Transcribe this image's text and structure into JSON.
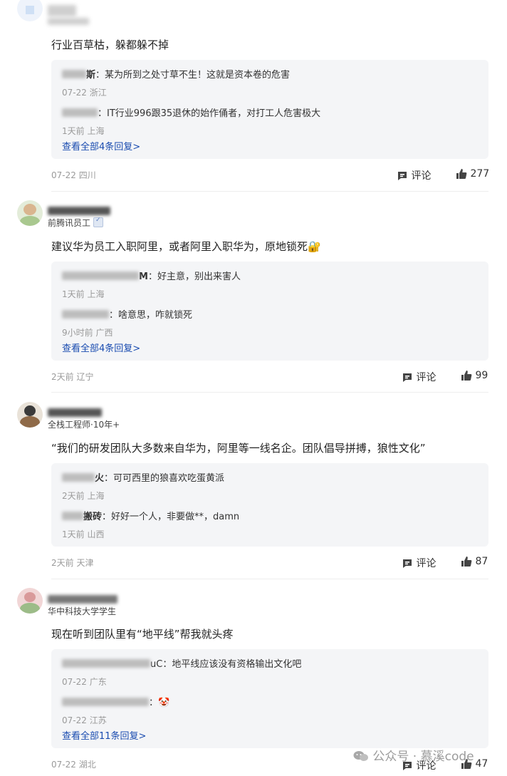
{
  "comments": [
    {
      "name_visible": "",
      "author_title": "",
      "verified": false,
      "text": "行业百草枯，躲都躲不掉",
      "replies": [
        {
          "name_tail": "斯",
          "text": "：某为所到之处寸草不生！这就是资本卷的危害",
          "date": "07-22",
          "location": "浙江"
        },
        {
          "name_tail": "",
          "text": "：IT行业996跟35退休的始作俑者，对打工人危害极大",
          "date": "1天前",
          "location": "上海"
        }
      ],
      "view_all": "查看全部4条回复>",
      "date": "07-22",
      "location": "四川",
      "comment_label": "评论",
      "likes": "277"
    },
    {
      "name_visible": "",
      "author_title": "前腾讯员工",
      "verified": true,
      "text": "建议华为员工入职阿里，或者阿里入职华为，原地锁死🔐",
      "replies": [
        {
          "name_tail": "M",
          "text": "：好主意，别出来害人",
          "date": "1天前",
          "location": "上海"
        },
        {
          "name_tail": "",
          "text": "：啥意思，咋就锁死",
          "date": "9小时前",
          "location": "广西"
        }
      ],
      "view_all": "查看全部4条回复>",
      "date": "2天前",
      "location": "辽宁",
      "comment_label": "评论",
      "likes": "99"
    },
    {
      "name_visible": "",
      "author_title": "全栈工程师·10年+",
      "verified": false,
      "text": "“我们的研发团队大多数来自华为，阿里等一线名企。团队倡导拼搏，狼性文化”",
      "replies": [
        {
          "name_tail": "火",
          "text": "：可可西里的狼喜欢吃蛋黄派",
          "date": "2天前",
          "location": "上海"
        },
        {
          "name_tail": "搬砖",
          "text": "：好好一个人，非要做**，damn",
          "date": "1天前",
          "location": "山西"
        }
      ],
      "view_all": "",
      "date": "2天前",
      "location": "天津",
      "comment_label": "评论",
      "likes": "87"
    },
    {
      "name_visible": "",
      "author_title": "华中科技大学学生",
      "verified": false,
      "text": "现在听到团队里有“地平线”帮我就头疼",
      "replies": [
        {
          "name_tail": "uC",
          "text": "：地平线应该没有资格输出文化吧",
          "date": "07-22",
          "location": "广东"
        },
        {
          "name_tail": "",
          "text": "：🤡",
          "date": "07-22",
          "location": "江苏"
        }
      ],
      "view_all": "查看全部11条回复>",
      "date": "07-22",
      "location": "湖北",
      "comment_label": "评论",
      "likes": "47"
    }
  ],
  "watermark": {
    "text": "公众号 · 慕溪code"
  },
  "colors": {
    "link": "#1a4cb0",
    "meta": "#9a9a9a",
    "reply_bg": "#f4f5f7"
  }
}
